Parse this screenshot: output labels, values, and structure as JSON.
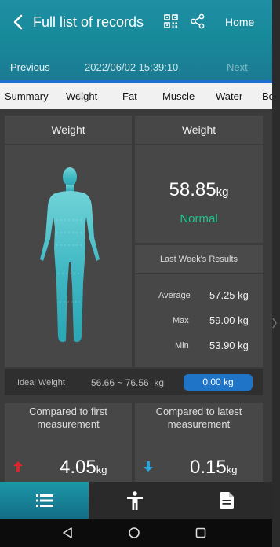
{
  "header": {
    "title": "Full list of records",
    "home_label": "Home",
    "prev_label": "Previous",
    "datetime": "2022/06/02 15:39:10",
    "next_label": "Next"
  },
  "tabs": [
    {
      "label": "Summary"
    },
    {
      "label": "Weight"
    },
    {
      "label": "Fat"
    },
    {
      "label": "Muscle"
    },
    {
      "label": "Water"
    },
    {
      "label": "Bo"
    }
  ],
  "left_card": {
    "title": "Weight"
  },
  "right_card": {
    "title": "Weight",
    "value": "58.85",
    "unit": "kg",
    "status": "Normal",
    "status_color": "#1fc48a"
  },
  "last_week": {
    "title": "Last Week's Results",
    "rows": [
      {
        "label": "Average",
        "value": "57.25",
        "unit": "kg"
      },
      {
        "label": "Max",
        "value": "59.00",
        "unit": "kg"
      },
      {
        "label": "Min",
        "value": "53.90",
        "unit": "kg"
      }
    ]
  },
  "ideal": {
    "label": "Ideal Weight",
    "range": "56.66 ~ 76.56  kg",
    "badge": "0.00 kg",
    "badge_color": "#1f74c8"
  },
  "compare_first": {
    "title": "Compared to first measurement",
    "value": "4.05",
    "unit": "kg",
    "direction": "up",
    "arrow_color": "#e0242a"
  },
  "compare_latest": {
    "title": "Compared to latest measurement",
    "value": "0.15",
    "unit": "kg",
    "direction": "down",
    "arrow_color": "#25a7de"
  },
  "bottom_nav": [
    {
      "icon": "list-icon",
      "active": true
    },
    {
      "icon": "person-icon",
      "active": false
    },
    {
      "icon": "document-icon",
      "active": false
    }
  ],
  "system_nav": [
    {
      "icon": "back-triangle-icon"
    },
    {
      "icon": "home-circle-icon"
    },
    {
      "icon": "recents-square-icon"
    }
  ],
  "accent_color": "#178a9a"
}
